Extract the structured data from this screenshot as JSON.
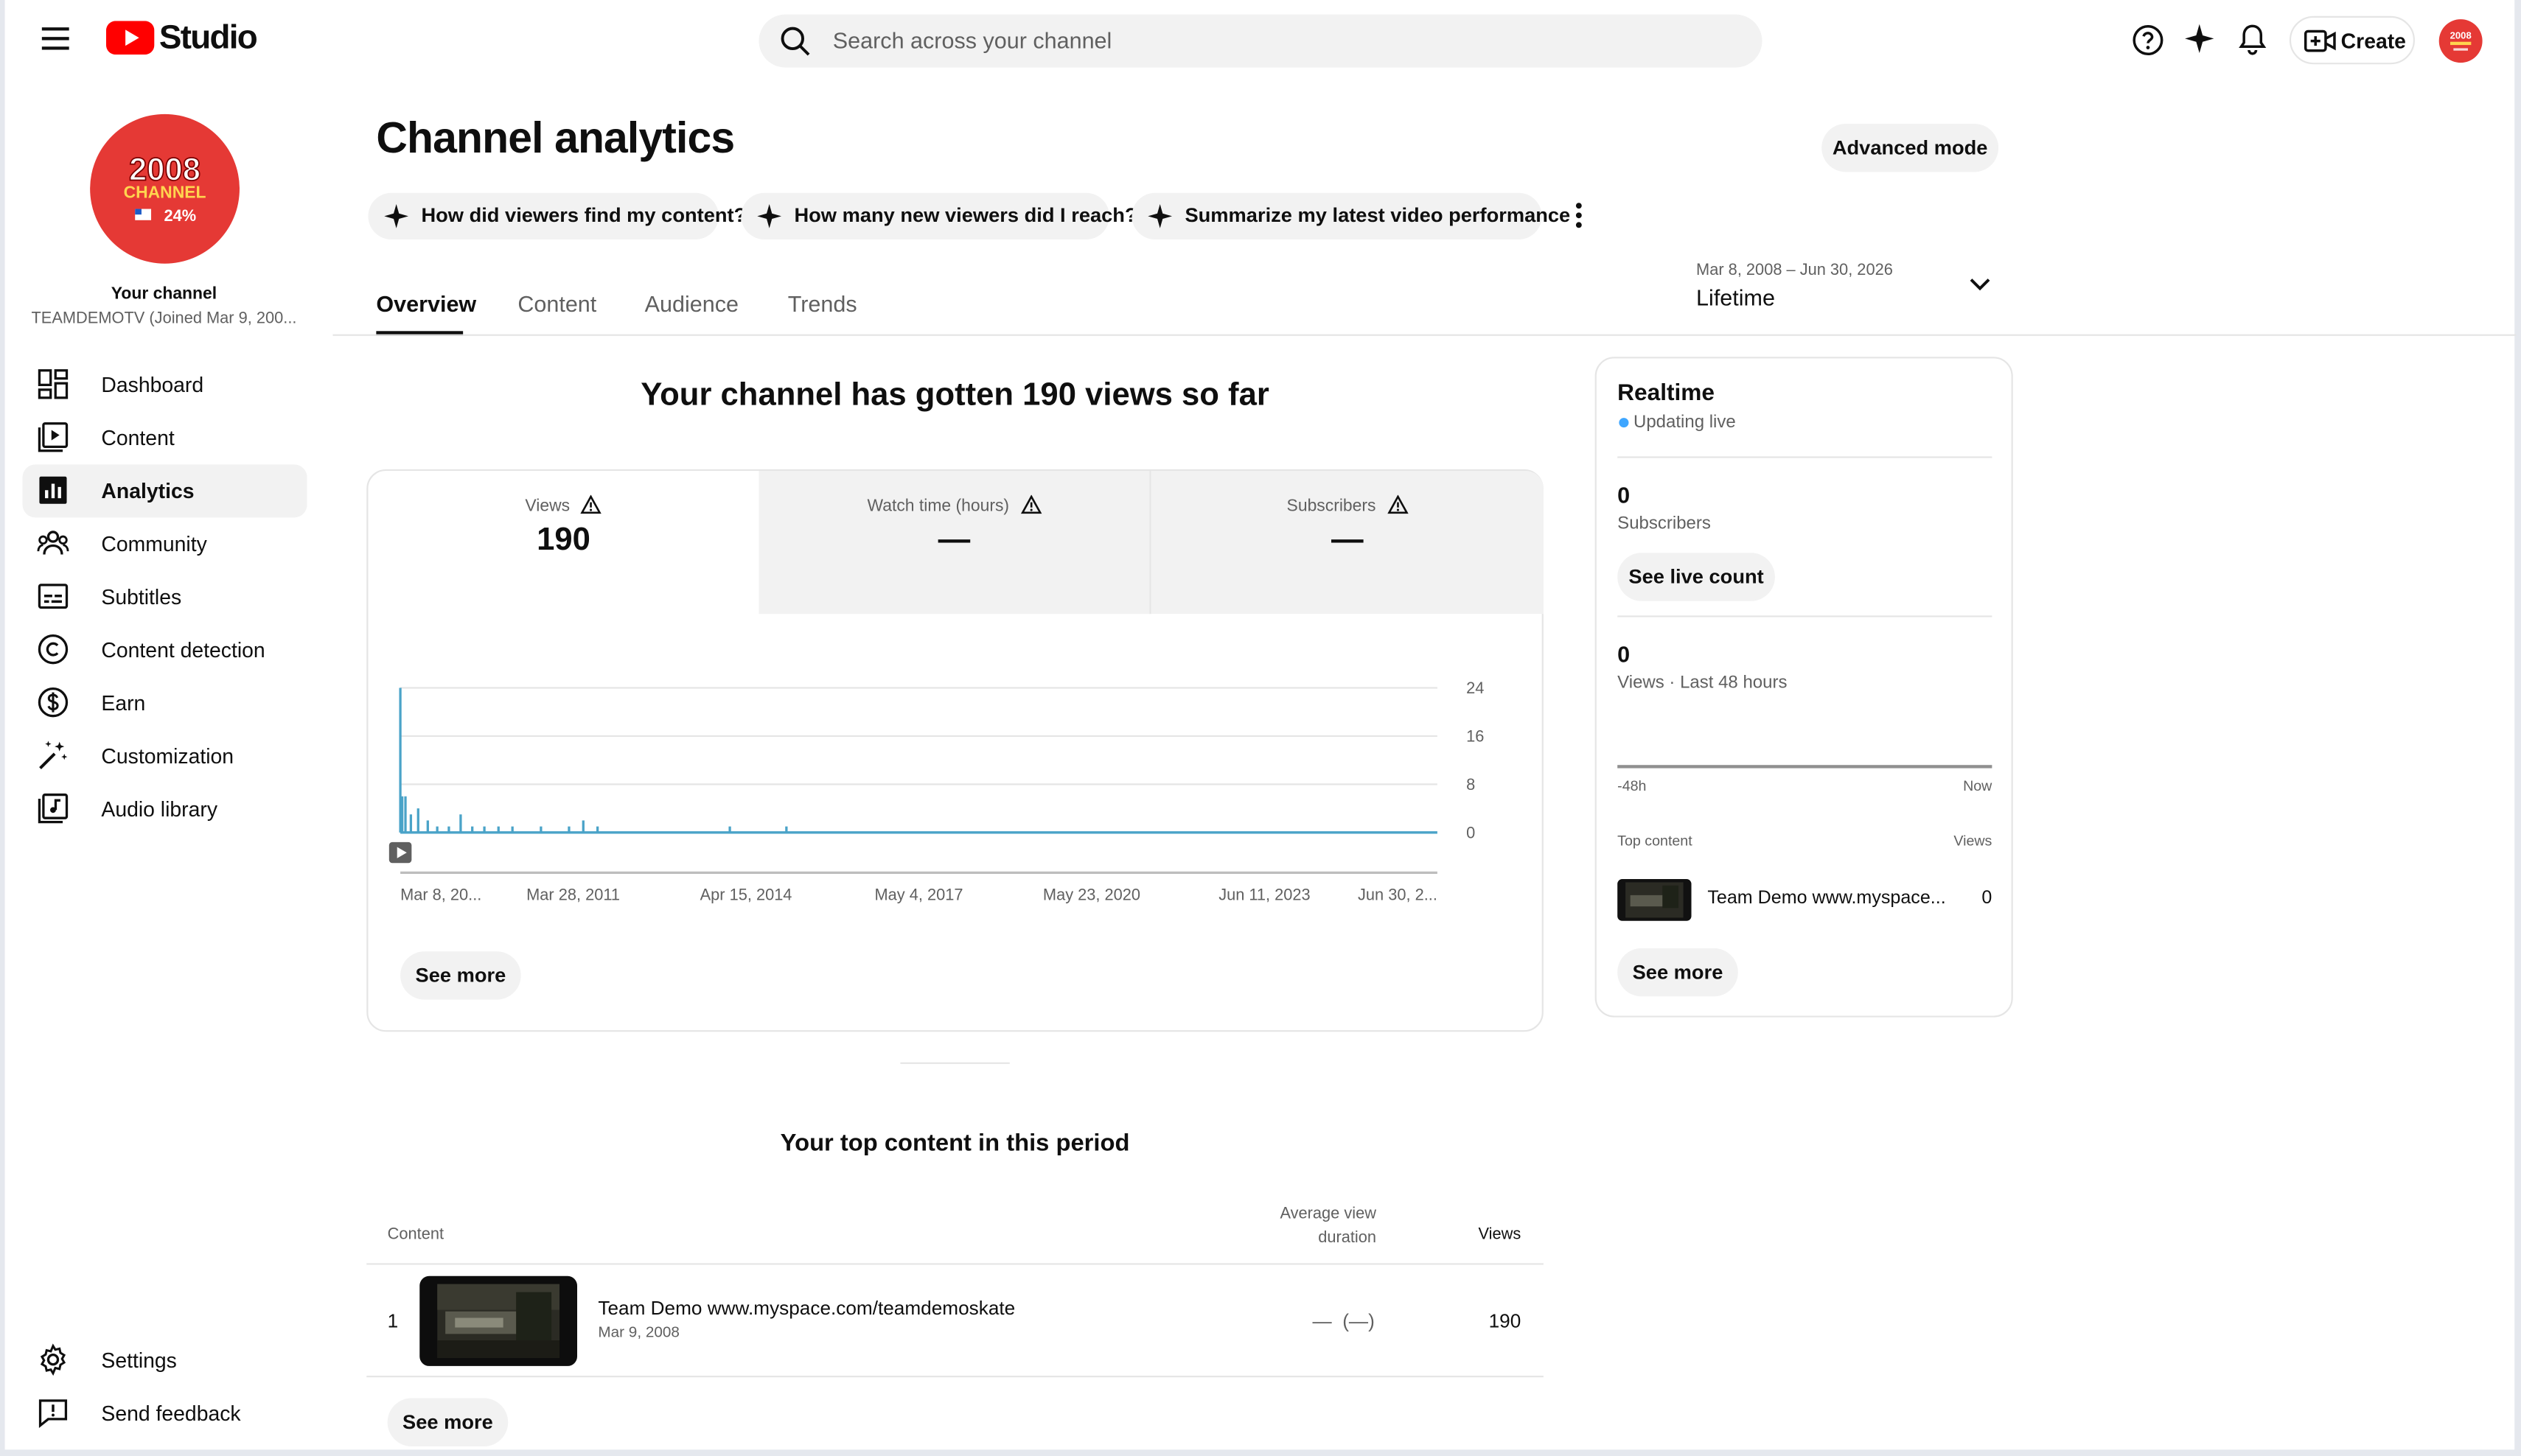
{
  "app": {
    "brand": "Studio"
  },
  "search": {
    "placeholder": "Search across your channel"
  },
  "header": {
    "create_label": "Create"
  },
  "sidebar": {
    "channel_label": "Your channel",
    "channel_name": "TEAMDEMOTV (Joined Mar 9, 200...",
    "items": [
      {
        "label": "Dashboard",
        "icon": "dashboard-icon"
      },
      {
        "label": "Content",
        "icon": "content-icon"
      },
      {
        "label": "Analytics",
        "icon": "analytics-icon",
        "active": true
      },
      {
        "label": "Community",
        "icon": "community-icon"
      },
      {
        "label": "Subtitles",
        "icon": "subtitles-icon"
      },
      {
        "label": "Content detection",
        "icon": "copyright-icon"
      },
      {
        "label": "Earn",
        "icon": "dollar-icon"
      },
      {
        "label": "Customization",
        "icon": "magic-wand-icon"
      },
      {
        "label": "Audio library",
        "icon": "audio-library-icon"
      }
    ],
    "footer_items": [
      {
        "label": "Settings",
        "icon": "gear-icon"
      },
      {
        "label": "Send feedback",
        "icon": "feedback-icon"
      }
    ]
  },
  "page": {
    "title": "Channel analytics",
    "advanced_mode": "Advanced mode",
    "prompts": [
      "How did viewers find my content?",
      "How many new viewers did I reach?",
      "Summarize my latest video performance"
    ],
    "tabs": [
      "Overview",
      "Content",
      "Audience",
      "Trends"
    ],
    "date_range": "Mar 8, 2008 – Jun 30, 2026",
    "date_preset": "Lifetime",
    "headline": "Your channel has gotten 190 views so far"
  },
  "metrics": [
    {
      "label": "Views",
      "value": "190"
    },
    {
      "label": "Watch time (hours)",
      "value": "—"
    },
    {
      "label": "Subscribers",
      "value": "—"
    }
  ],
  "chart_data": {
    "type": "area",
    "x_tick_labels": [
      "Mar 8, 20...",
      "Mar 28, 2011",
      "Apr 15, 2014",
      "May 4, 2017",
      "May 23, 2020",
      "Jun 11, 2023",
      "Jun 30, 2..."
    ],
    "y_ticks": [
      0,
      8,
      16,
      24
    ],
    "ylim": [
      0,
      24
    ],
    "x": [
      "2008-03-08",
      "2008-03-20",
      "2008-04-10",
      "2008-05-15",
      "2008-07-01",
      "2008-09-01",
      "2008-11-01",
      "2009-01-15",
      "2009-04-01",
      "2009-06-15",
      "2009-09-01",
      "2009-12-01",
      "2010-03-01",
      "2010-09-01",
      "2011-03-01",
      "2011-06-01",
      "2011-09-01",
      "2012-01-01",
      "2013-01-01",
      "2014-01-01",
      "2015-01-01",
      "2020-01-01",
      "2026-06-30"
    ],
    "values": [
      30,
      6,
      6,
      3,
      4,
      2,
      1,
      1,
      3,
      1,
      1,
      1,
      1,
      1,
      1,
      2,
      1,
      0,
      0,
      1,
      1,
      0,
      0
    ],
    "grid": true
  },
  "see_more": "See more",
  "realtime": {
    "title": "Realtime",
    "status": "Updating live",
    "subscribers_value": "0",
    "subscribers_label": "Subscribers",
    "live_count_btn": "See live count",
    "views_value": "0",
    "views_label": "Views · Last 48 hours",
    "axis_start": "-48h",
    "axis_end": "Now",
    "top_content_label": "Top content",
    "views_col": "Views",
    "top_item_title": "Team Demo www.myspace...",
    "top_item_views": "0",
    "see_more": "See more"
  },
  "top_content": {
    "heading": "Your top content in this period",
    "col_content": "Content",
    "col_avg_line1": "Average view",
    "col_avg_line2": "duration",
    "col_views": "Views",
    "rows": [
      {
        "rank": "1",
        "title": "Team Demo www.myspace.com/teamdemoskate",
        "date": "Mar 9, 2008",
        "avg": "—  (—)",
        "views": "190"
      }
    ],
    "see_more": "See more"
  },
  "colors": {
    "brand_red": "#ff0000",
    "accent_blue": "#3ea6ff",
    "chart_blue": "#4aa3c8"
  }
}
